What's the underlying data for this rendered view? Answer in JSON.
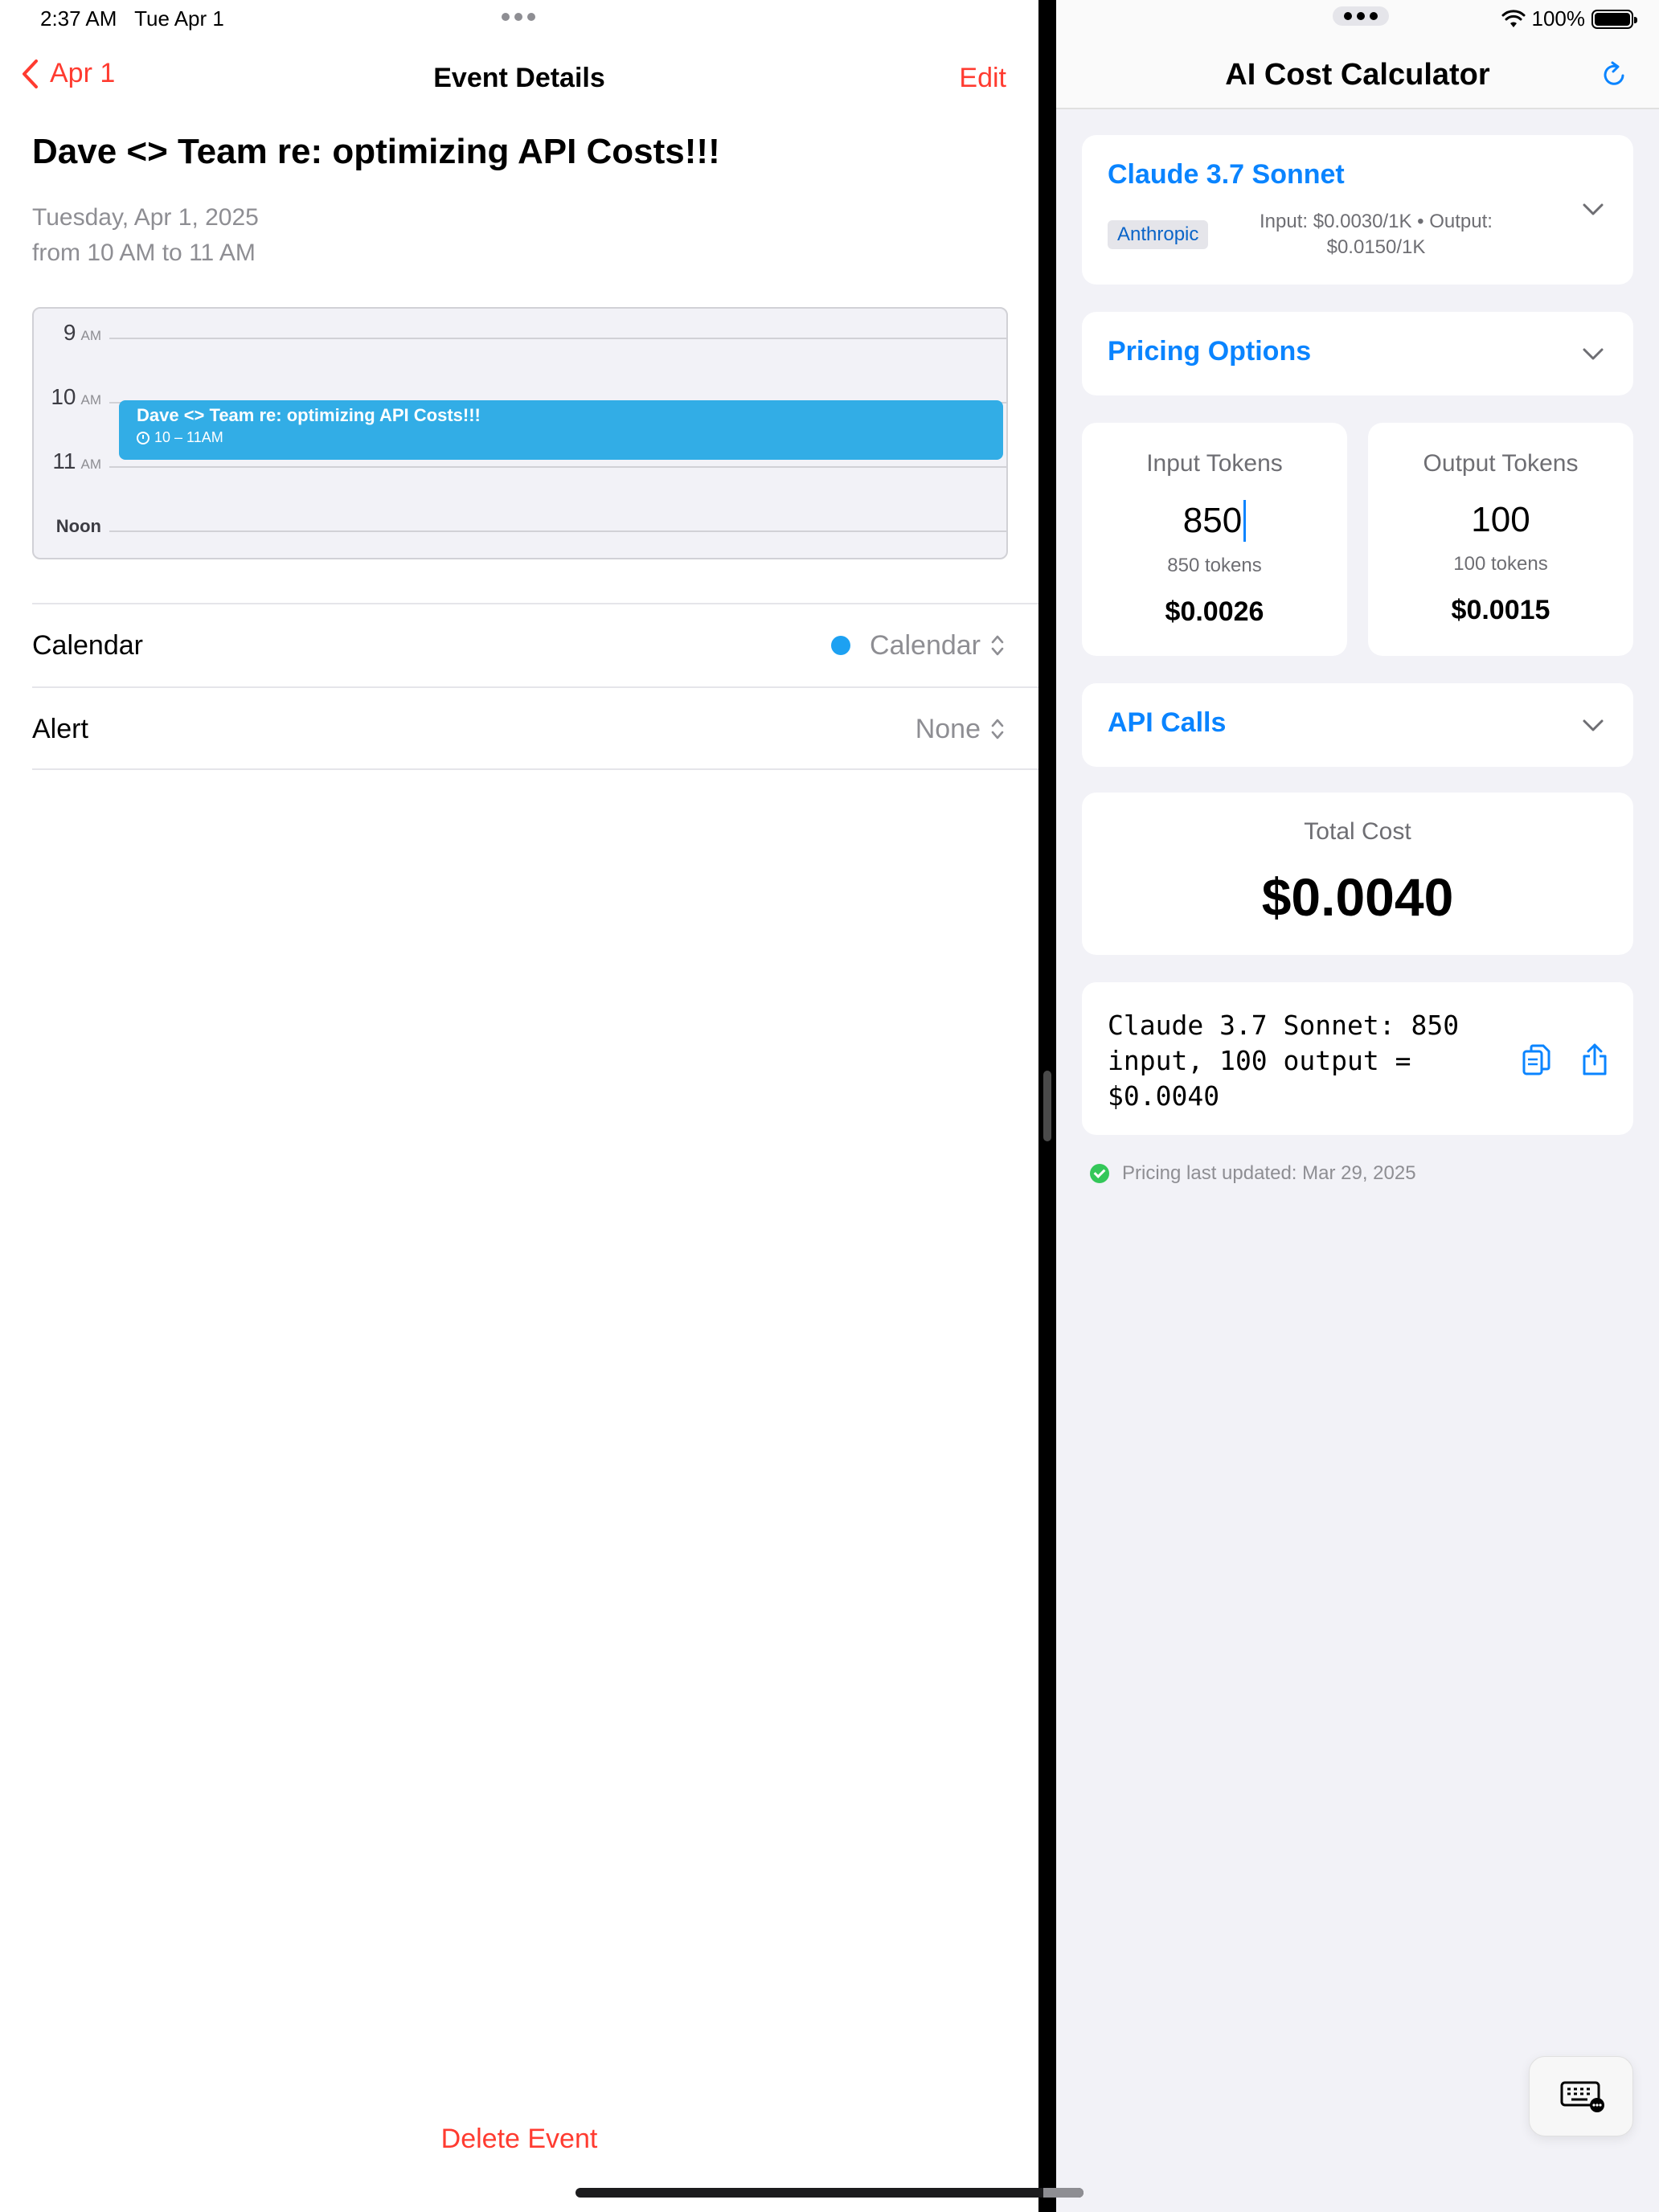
{
  "status_bar": {
    "time": "2:37 AM",
    "date": "Tue Apr 1",
    "battery": "100%"
  },
  "calendar_app": {
    "nav": {
      "back_label": "Apr 1",
      "title": "Event Details",
      "edit_label": "Edit"
    },
    "event": {
      "title": "Dave <> Team re: optimizing API Costs!!!",
      "date": "Tuesday, Apr 1, 2025",
      "time_range": "from 10 AM to 11 AM"
    },
    "day_view": {
      "hours": [
        {
          "hour": "9",
          "suffix": "AM"
        },
        {
          "hour": "10",
          "suffix": "AM"
        },
        {
          "hour": "11",
          "suffix": "AM"
        }
      ],
      "noon_label": "Noon",
      "event_block": {
        "title": "Dave <> Team re: optimizing API Costs!!!",
        "time": "10 – 11AM",
        "color": "#32ade6"
      }
    },
    "fields": {
      "calendar": {
        "label": "Calendar",
        "value": "Calendar",
        "color": "#1da1f2"
      },
      "alert": {
        "label": "Alert",
        "value": "None"
      }
    },
    "delete_label": "Delete Event"
  },
  "cost_app": {
    "title": "AI Cost Calculator",
    "model": {
      "name": "Claude 3.7 Sonnet",
      "provider": "Anthropic",
      "pricing_line1": "Input: $0.0030/1K • Output:",
      "pricing_line2": "$0.0150/1K"
    },
    "pricing_options_label": "Pricing Options",
    "input_tokens": {
      "label": "Input Tokens",
      "value": "850",
      "sub": "850 tokens",
      "cost": "$0.0026"
    },
    "output_tokens": {
      "label": "Output Tokens",
      "value": "100",
      "sub": "100 tokens",
      "cost": "$0.0015"
    },
    "api_calls_label": "API Calls",
    "total": {
      "label": "Total Cost",
      "value": "$0.0040"
    },
    "summary": "Claude 3.7 Sonnet: 850 input, 100 output = $0.0040",
    "updated": "Pricing last updated: Mar 29, 2025",
    "accent_color": "#0a84ff"
  }
}
